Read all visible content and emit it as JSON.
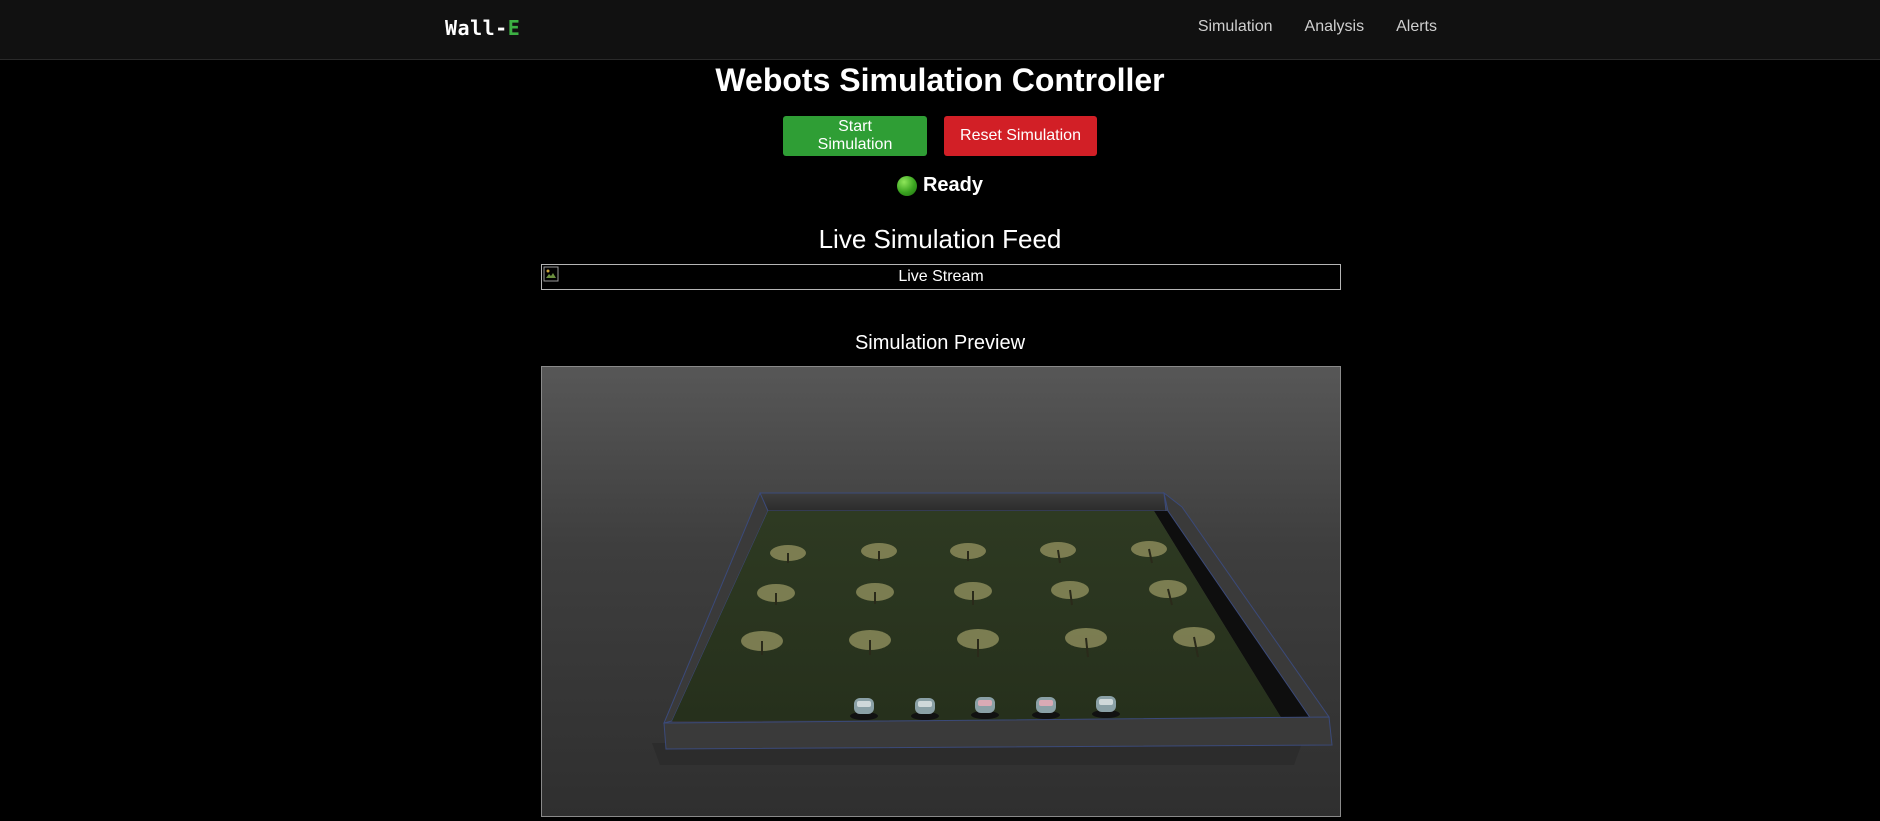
{
  "navbar": {
    "brand_prefix": "Wall-",
    "brand_accent": "E",
    "links": [
      "Simulation",
      "Analysis",
      "Alerts"
    ]
  },
  "page": {
    "title": "Webots Simulation Controller"
  },
  "controls": {
    "start_label": "Start Simulation",
    "reset_label": "Reset Simulation"
  },
  "status": {
    "text": "Ready",
    "color": "#3aa320"
  },
  "live_feed": {
    "heading": "Live Simulation Feed",
    "image_alt": "Live Stream"
  },
  "preview": {
    "heading": "Simulation Preview"
  },
  "colors": {
    "accent_green": "#3cb043",
    "start_button": "#2f9e35",
    "reset_button": "#d21f26",
    "background": "#000000"
  }
}
